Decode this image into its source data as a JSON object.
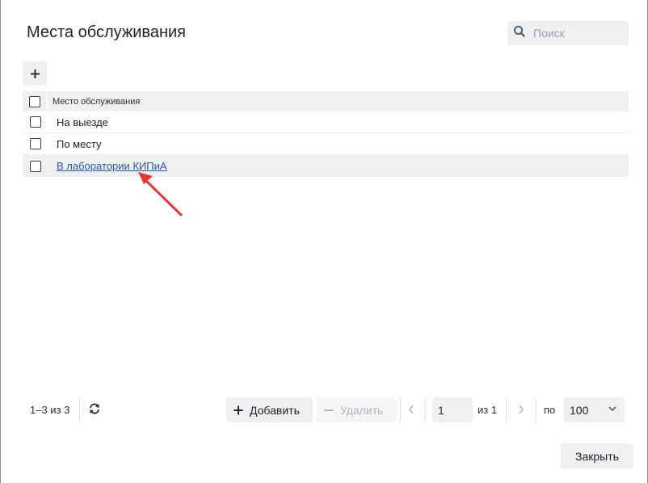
{
  "dialog": {
    "title": "Места обслуживания",
    "search": {
      "placeholder": "Поиск",
      "value": "",
      "icon": "search-icon"
    }
  },
  "toolbar": {
    "add_icon": "plus-icon"
  },
  "table": {
    "header": {
      "column": "Место обслуживания"
    },
    "rows": [
      {
        "label": "На выезде",
        "is_link": false,
        "checked": false
      },
      {
        "label": "По месту",
        "is_link": false,
        "checked": false
      },
      {
        "label": "В лаборатории КИПиА",
        "is_link": true,
        "checked": false,
        "highlighted": true
      }
    ]
  },
  "footer": {
    "count": "1–3 из 3",
    "add_label": "Добавить",
    "delete_label": "Удалить",
    "page_value": "1",
    "of_pages": "из 1",
    "per_label": "по",
    "page_size": "100",
    "close_label": "Закрыть"
  },
  "colors": {
    "accent_link": "#2a56a8",
    "panel_bg": "#eef0f2",
    "annotation_arrow": "#e03a32"
  }
}
